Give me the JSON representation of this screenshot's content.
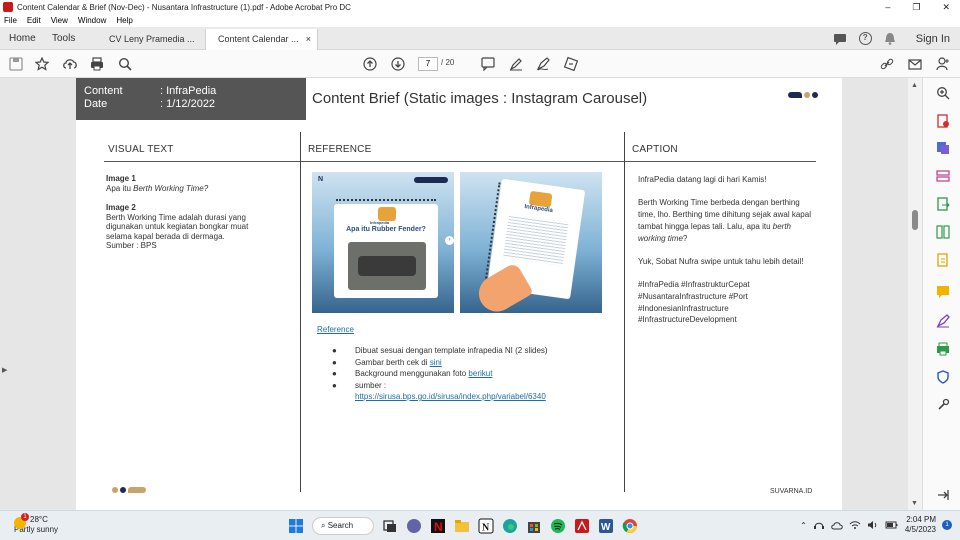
{
  "window": {
    "title": "Content Calendar & Brief (Nov-Dec) - Nusantara Infrastructure (1).pdf - Adobe Acrobat Pro DC",
    "controls": [
      "–",
      "❐",
      "✕"
    ]
  },
  "menu": [
    "File",
    "Edit",
    "View",
    "Window",
    "Help"
  ],
  "tabs": {
    "home": "Home",
    "tools": "Tools",
    "doc1": "CV Leny Pramedia ...",
    "doc2": "Content Calendar ...",
    "close": "×",
    "sign_in": "Sign In"
  },
  "toolbar": {
    "current_page": "7",
    "total_pages": "/ 20"
  },
  "page": {
    "header": {
      "content_key": "Content",
      "content_val": ": InfraPedia",
      "date_key": "Date",
      "date_val": ": 1/12/2022"
    },
    "title": "Content Brief (Static images : Instagram Carousel)",
    "columns": {
      "visual": "VISUAL TEXT",
      "reference": "REFERENCE",
      "caption": "CAPTION"
    },
    "visual_text": {
      "img1_label": "Image 1",
      "img1_text": "Apa itu ",
      "img1_italic": "Berth Working Time?",
      "img2_label": "Image 2",
      "img2_text": "Berth Working Time adalah durasi yang digunakan untuk kegiatan bongkar muat selama kapal berada di dermaga.",
      "source": "Sumber : BPS"
    },
    "slides": {
      "slide1_brand": "Infrapedia",
      "slide1_question": "Apa itu Rubber Fender?",
      "slide2_brand": "Infrapedia"
    },
    "reference": {
      "link_label": "Reference",
      "items": [
        {
          "text": "Dibuat sesuai dengan template infrapedia NI (2 slides)",
          "link": ""
        },
        {
          "text": "Gambar berth cek di ",
          "link": "sini"
        },
        {
          "text": "Background  menggunakan foto ",
          "link": "berikut"
        },
        {
          "text": "sumber :",
          "link": ""
        }
      ],
      "source_url": "https://sirusa.bps.go.id/sirusa/index.php/variabel/6340"
    },
    "caption": {
      "p1": "InfraPedia datang lagi di hari Kamis!",
      "p2a": "Berth Working Time berbeda dengan berthing time, lho. Berthing  time dihitung sejak awal kapal tambat hingga lepas tali. Lalu, apa itu ",
      "p2b": "berth working time",
      "p2c": "?",
      "p3": "Yuk, Sobat Nufra swipe untuk tahu lebih detail!",
      "tags1": "#InfraPedia #InfrastrukturCepat",
      "tags2": "#NusantaraInfrastructure #Port",
      "tags3": "#IndonesianInfrastructure",
      "tags4": "#InfrastructureDevelopment"
    },
    "footer_brand": "SUVARNA.ID"
  },
  "taskbar": {
    "temp": "28°C",
    "condition": "Partly sunny",
    "alert_count": "1",
    "search": "Search",
    "time": "2:04 PM",
    "date": "4/5/2023",
    "notif_count": "1"
  },
  "colors": {
    "acrobat_red": "#c81a1a",
    "header_gray": "#555555",
    "link_blue": "#1c6ea4",
    "navy": "#1e2a52",
    "gold": "#caa36a"
  }
}
